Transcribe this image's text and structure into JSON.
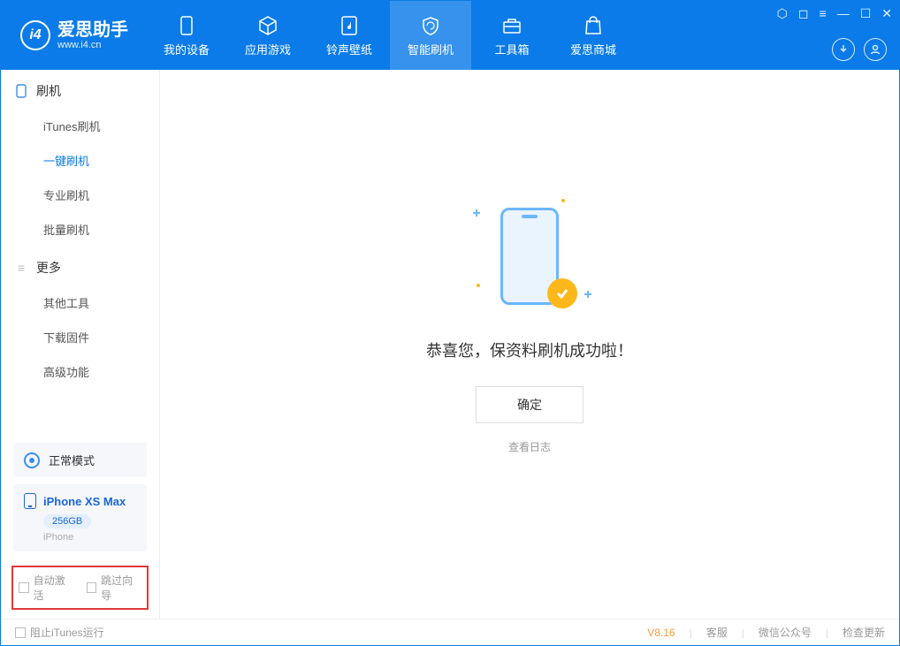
{
  "app": {
    "name": "爱思助手",
    "url": "www.i4.cn"
  },
  "nav": {
    "tabs": [
      {
        "label": "我的设备"
      },
      {
        "label": "应用游戏"
      },
      {
        "label": "铃声壁纸"
      },
      {
        "label": "智能刷机"
      },
      {
        "label": "工具箱"
      },
      {
        "label": "爱思商城"
      }
    ]
  },
  "sidebar": {
    "section1": {
      "title": "刷机",
      "items": [
        "iTunes刷机",
        "一键刷机",
        "专业刷机",
        "批量刷机"
      ]
    },
    "section2": {
      "title": "更多",
      "items": [
        "其他工具",
        "下载固件",
        "高级功能"
      ]
    },
    "mode_label": "正常模式",
    "device": {
      "name": "iPhone XS Max",
      "storage": "256GB",
      "type": "iPhone"
    },
    "checkboxes": {
      "auto_activate": "自动激活",
      "skip_guide": "跳过向导"
    }
  },
  "main": {
    "success_text": "恭喜您，保资料刷机成功啦！",
    "ok_button": "确定",
    "view_log": "查看日志"
  },
  "footer": {
    "block_itunes": "阻止iTunes运行",
    "version": "V8.16",
    "links": {
      "support": "客服",
      "wechat": "微信公众号",
      "update": "检查更新"
    }
  }
}
